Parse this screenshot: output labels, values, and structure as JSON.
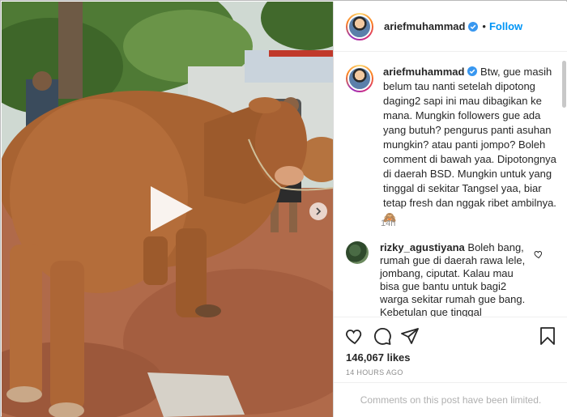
{
  "post": {
    "username": "ariefmuhammad",
    "follow_label": "Follow",
    "dot": "•"
  },
  "caption": {
    "username": "ariefmuhammad",
    "text": "Btw, gue masih belum tau nanti setelah dipotong daging2 sapi ini mau dibagikan ke mana. Mungkin followers gue ada yang butuh? pengurus panti asuhan mungkin? atau panti jompo? Boleh comment di bawah yaa. Dipotongnya di daerah BSD. Mungkin untuk yang tinggal di sekitar Tangsel yaa, biar tetap fresh dan nggak ribet ambilnya. 🙈",
    "time": "14h"
  },
  "comment": {
    "username": "rizky_agustiyana",
    "text": "Boleh bang, rumah gue di daerah rawa lele, jombang, ciputat. Kalau mau bisa gue bantu untuk bagi2 warga sekitar rumah gue bang. Kebetulan gue tinggal"
  },
  "stats": {
    "likes": "146,067 likes",
    "posted": "14 HOURS AGO"
  },
  "footer": {
    "comments_limited": "Comments on this post have been limited."
  },
  "icons": {
    "verified": "verified-badge-icon",
    "like": "heart-icon",
    "comment": "comment-icon",
    "share": "share-icon",
    "save": "bookmark-icon",
    "play": "play-icon",
    "next": "chevron-right-icon"
  },
  "colors": {
    "link_blue": "#0095f6",
    "verified_blue": "#3897f0",
    "muted": "#8e8e8e"
  }
}
